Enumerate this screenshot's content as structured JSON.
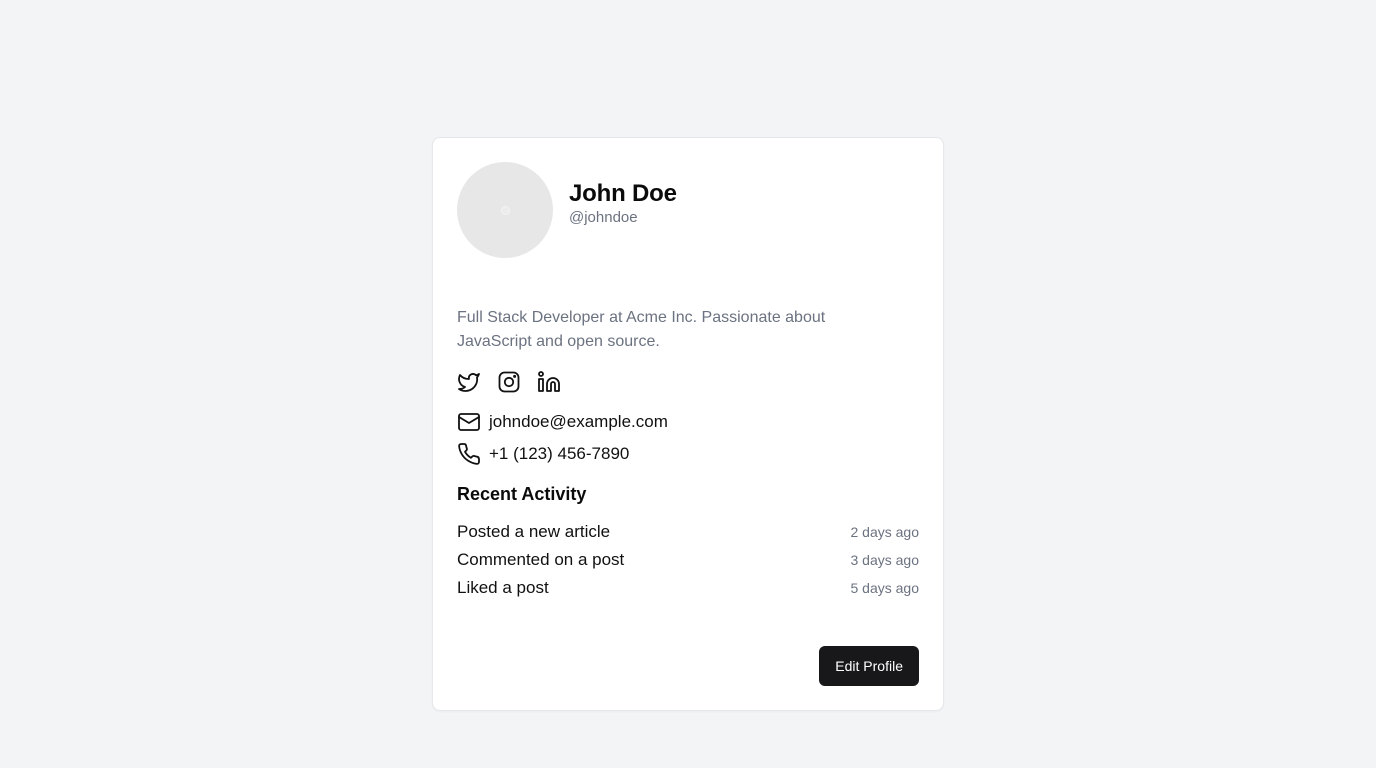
{
  "profile": {
    "name": "John Doe",
    "handle": "@johndoe",
    "bio": "Full Stack Developer at Acme Inc. Passionate about JavaScript and open source.",
    "avatar_icon": "avatar-placeholder"
  },
  "socials": [
    {
      "icon": "twitter-icon"
    },
    {
      "icon": "instagram-icon"
    },
    {
      "icon": "linkedin-icon"
    }
  ],
  "contact": {
    "email": "johndoe@example.com",
    "phone": "+1 (123) 456-7890"
  },
  "activity": {
    "title": "Recent Activity",
    "items": [
      {
        "label": "Posted a new article",
        "time": "2 days ago"
      },
      {
        "label": "Commented on a post",
        "time": "3 days ago"
      },
      {
        "label": "Liked a post",
        "time": "5 days ago"
      }
    ]
  },
  "actions": {
    "edit_label": "Edit Profile"
  },
  "colors": {
    "page_bg": "#f3f4f6",
    "card_bg": "#ffffff",
    "muted_text": "#6b7280",
    "button_bg": "#18181b"
  }
}
